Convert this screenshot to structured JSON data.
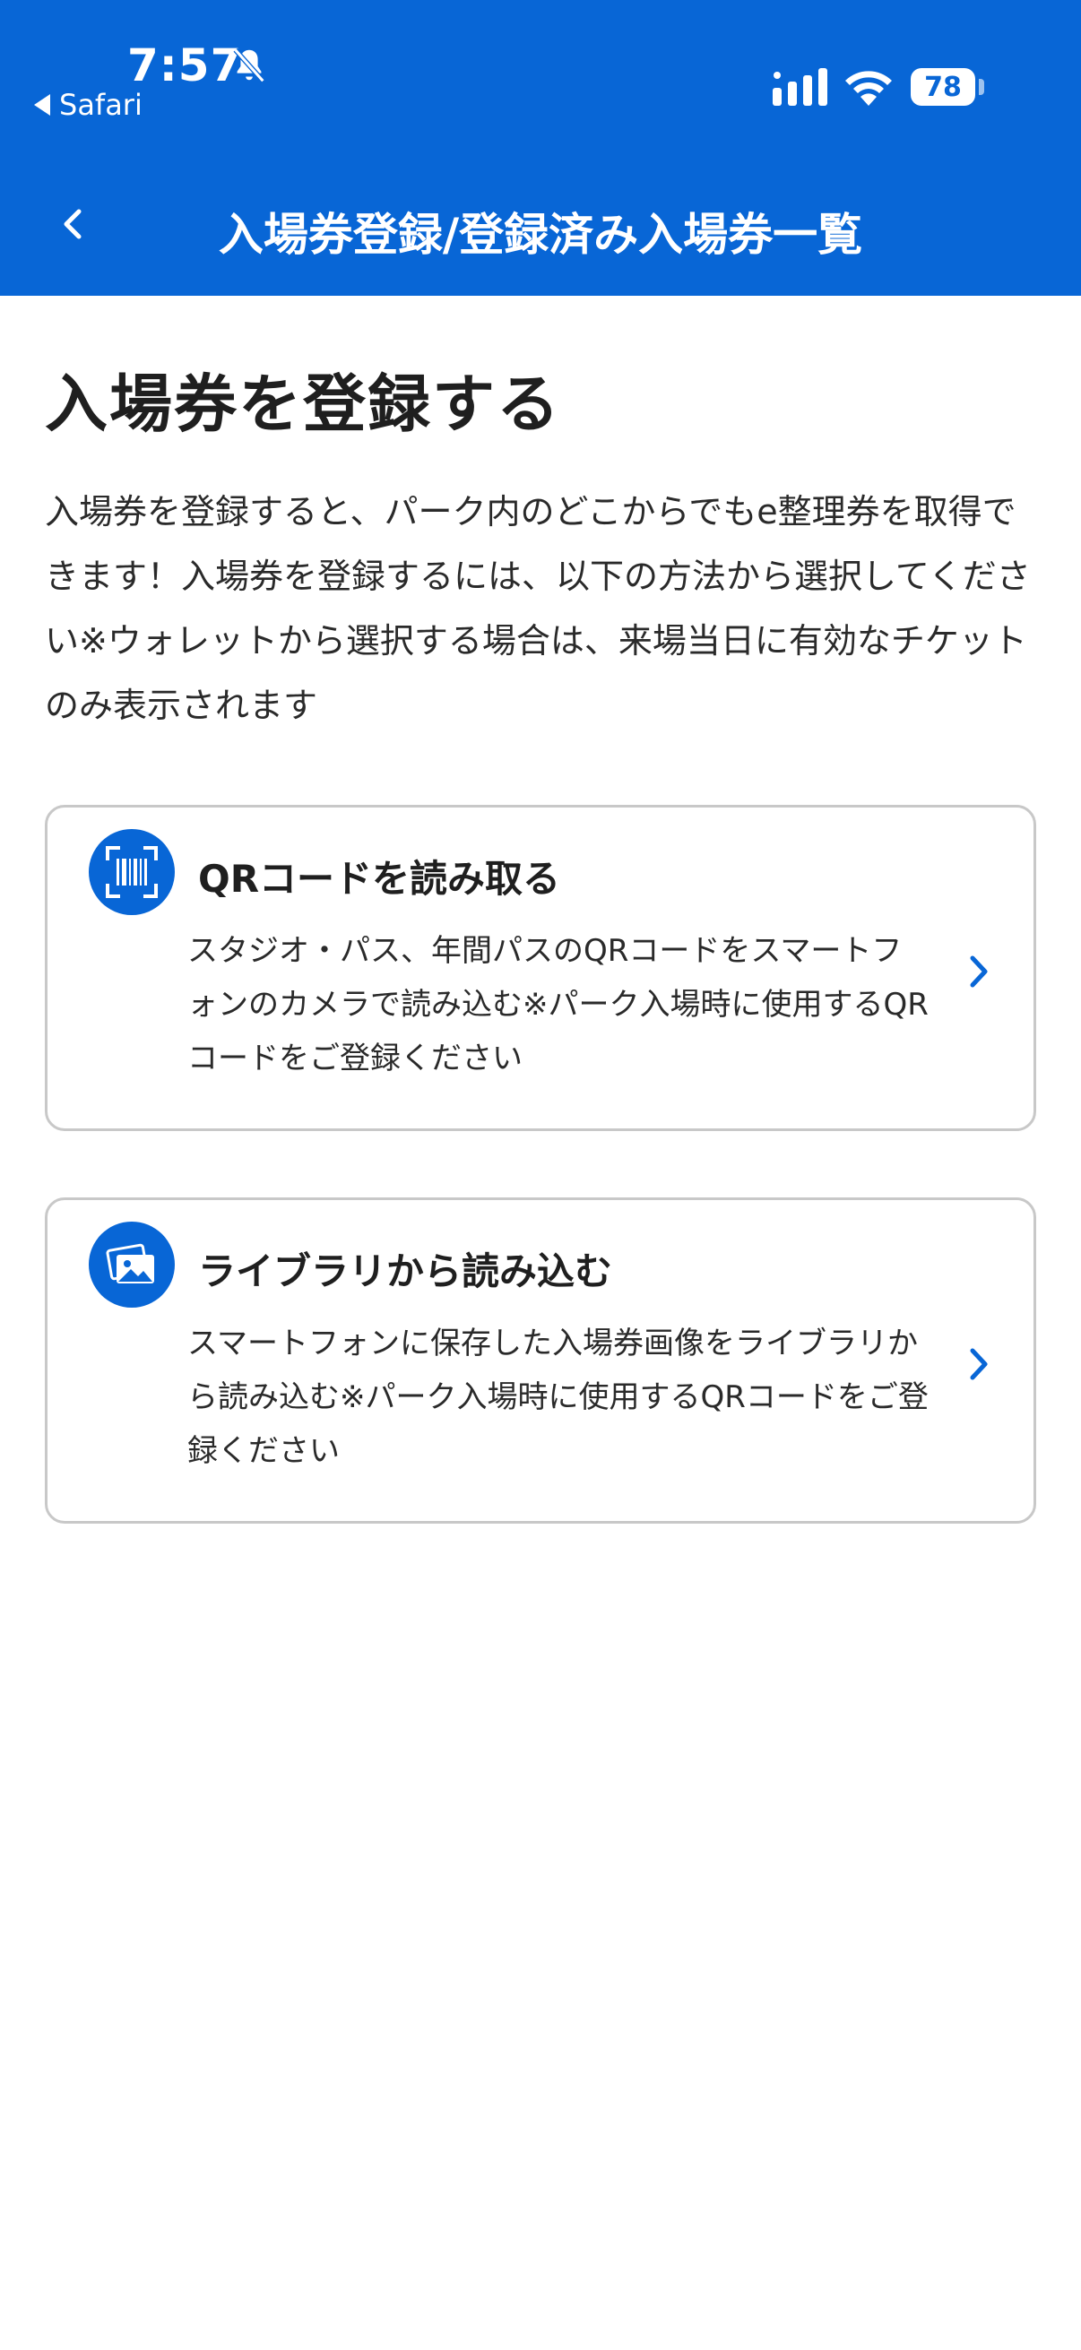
{
  "status_bar": {
    "time": "7:57",
    "back_app": "Safari",
    "battery": "78",
    "icons": [
      "bell-slash-icon",
      "signal-icon",
      "wifi-icon",
      "battery-icon"
    ]
  },
  "nav": {
    "title": "入場券登録/登録済み入場券一覧",
    "back_icon": "chevron-left-icon"
  },
  "main": {
    "title": "入場券を登録する",
    "intro": "入場券を登録すると、パーク内のどこからでもe整理券を取得できます！入場券を登録するには、以下の方法から選択してください※ウォレットから選択する場合は、来場当日に有効なチケットのみ表示されます"
  },
  "options": [
    {
      "title": "QRコードを読み取る",
      "description": "スタジオ・パス、年間パスのQRコードをスマートフォンのカメラで読み込む※パーク入場時に使用するQRコードをご登録ください",
      "icon": "qr-scan-icon"
    },
    {
      "title": "ライブラリから読み込む",
      "description": "スマートフォンに保存した入場券画像をライブラリから読み込む※パーク入場時に使用するQRコードをご登録ください",
      "icon": "photo-library-icon"
    }
  ],
  "colors": {
    "brand": "#0866d6",
    "card_border": "#c8c8c8",
    "text": "#1f1f1f"
  }
}
